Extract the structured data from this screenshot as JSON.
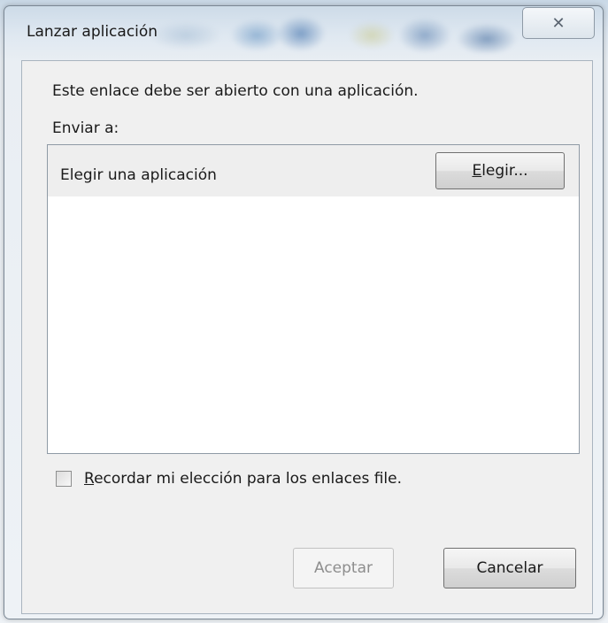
{
  "window": {
    "title": "Lanzar aplicación",
    "close_glyph": "✕"
  },
  "dialog": {
    "message": "Este enlace debe ser abierto con una aplicación.",
    "send_to_label": "Enviar a:",
    "app_list": [
      {
        "label": "Elegir una aplicación"
      }
    ],
    "choose_button": {
      "accel": "E",
      "rest": "legir..."
    },
    "remember_checkbox": {
      "checked": false,
      "accel": "R",
      "rest": "ecordar mi elección para los enlaces file."
    },
    "accept_button": {
      "label": "Aceptar",
      "enabled": false
    },
    "cancel_button": {
      "label": "Cancelar"
    }
  }
}
